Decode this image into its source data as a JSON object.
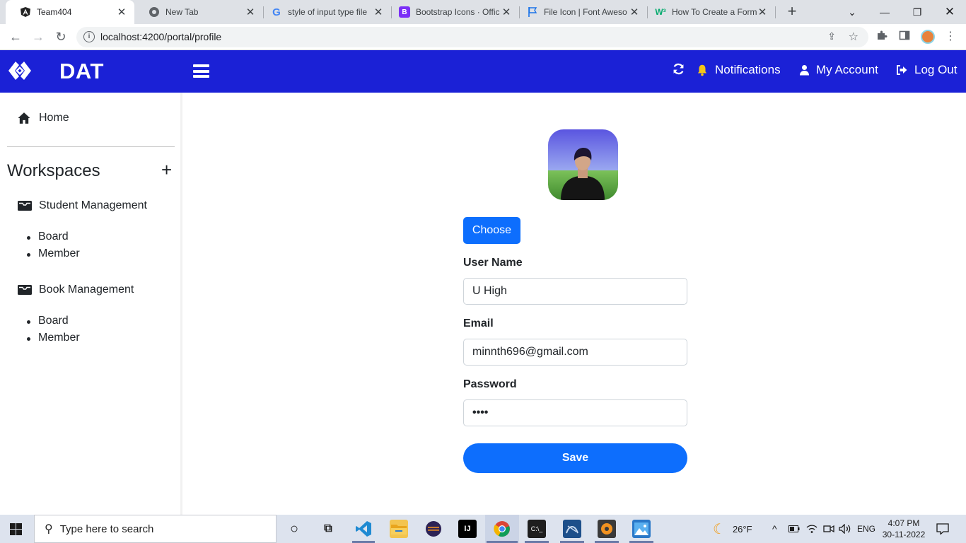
{
  "browser": {
    "tabs": [
      {
        "title": "Team404",
        "active": true
      },
      {
        "title": "New Tab"
      },
      {
        "title": "style of input type file"
      },
      {
        "title": "Bootstrap Icons · Offic"
      },
      {
        "title": "File Icon | Font Aweso"
      },
      {
        "title": "How To Create a Form"
      }
    ],
    "url": "localhost:4200/portal/profile"
  },
  "navbar": {
    "brand": "DAT",
    "notifications_label": "Notifications",
    "account_label": "My Account",
    "logout_label": "Log Out"
  },
  "sidebar": {
    "home_label": "Home",
    "workspaces_title": "Workspaces",
    "add_symbol": "+",
    "workspaces": [
      {
        "name": "Student Management",
        "items": [
          "Board",
          "Member"
        ]
      },
      {
        "name": "Book Management",
        "items": [
          "Board",
          "Member"
        ]
      }
    ]
  },
  "profile": {
    "choose_label": "Choose",
    "username_label": "User Name",
    "username_value": "U High",
    "email_label": "Email",
    "email_value": "minnth696@gmail.com",
    "password_label": "Password",
    "password_value": "••••",
    "save_label": "Save"
  },
  "taskbar": {
    "search_placeholder": "Type here to search",
    "weather": "26°F",
    "language": "ENG",
    "time": "4:07 PM",
    "date": "30-11-2022"
  },
  "colors": {
    "navbar": "#1b21d6",
    "primary_button": "#0d6efd",
    "bell": "#f5c518"
  }
}
